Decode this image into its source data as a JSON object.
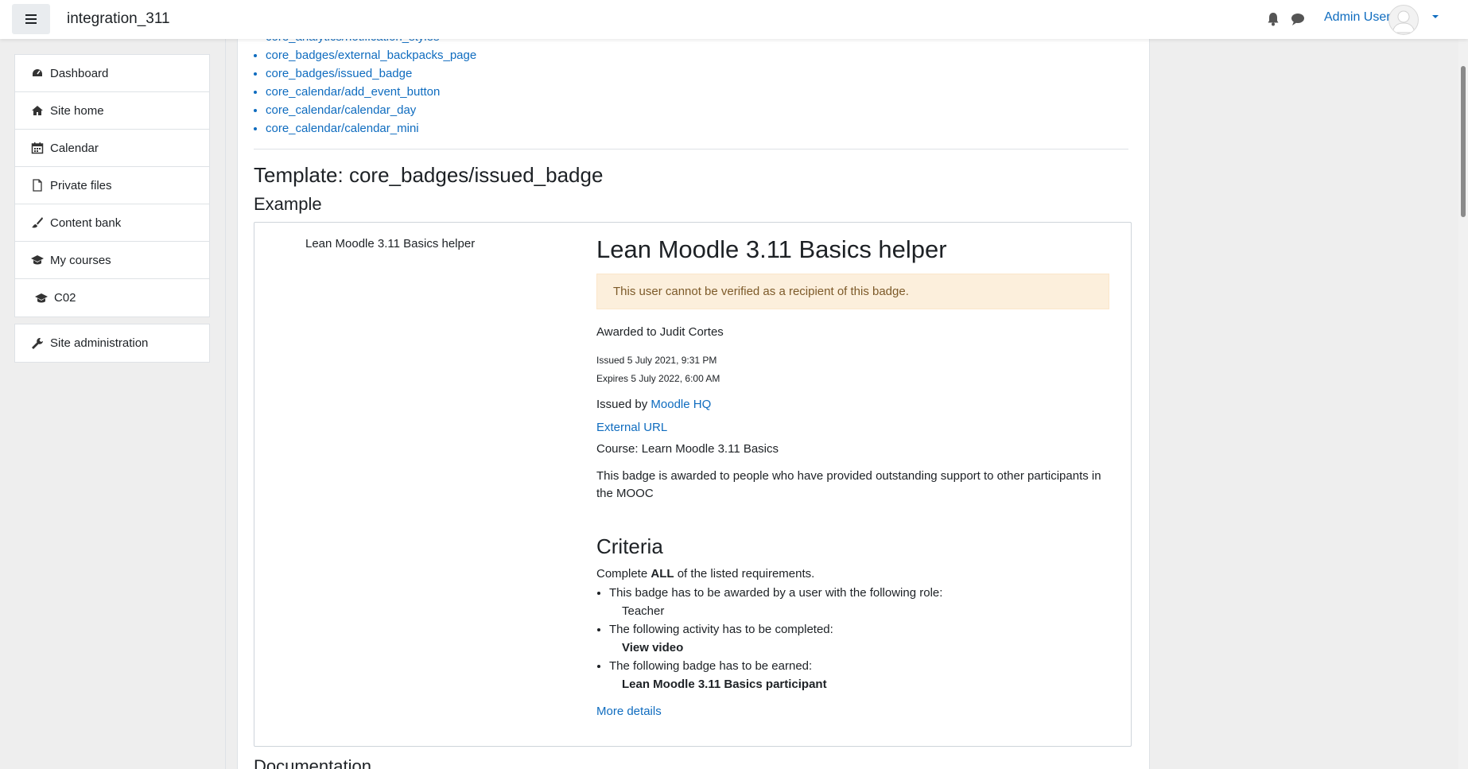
{
  "header": {
    "site_name": "integration_311",
    "user_name": "Admin User"
  },
  "nav": {
    "group1": [
      {
        "label": "Dashboard",
        "icon": "dashboard-icon"
      },
      {
        "label": "Site home",
        "icon": "home-icon"
      },
      {
        "label": "Calendar",
        "icon": "calendar-icon"
      },
      {
        "label": "Private files",
        "icon": "file-icon"
      },
      {
        "label": "Content bank",
        "icon": "brush-icon"
      },
      {
        "label": "My courses",
        "icon": "graduation-cap-icon"
      },
      {
        "label": "C02",
        "icon": "graduation-cap-icon"
      }
    ],
    "group2": [
      {
        "label": "Site administration",
        "icon": "wrench-icon"
      }
    ]
  },
  "template_list": [
    "core_analytics/notification_styles",
    "core_badges/external_backpacks_page",
    "core_badges/issued_badge",
    "core_calendar/add_event_button",
    "core_calendar/calendar_day",
    "core_calendar/calendar_mini"
  ],
  "main": {
    "template_title": "Template: core_badges/issued_badge",
    "example_heading": "Example",
    "documentation_heading": "Documentation"
  },
  "badge": {
    "image_caption": "Lean Moodle 3.11 Basics helper",
    "name": "Lean Moodle 3.11 Basics helper",
    "alert": "This user cannot be verified as a recipient of this badge.",
    "awarded_to": "Awarded to Judit Cortes",
    "issued": "Issued 5 July 2021, 9:31 PM",
    "expires": "Expires 5 July 2022, 6:00 AM",
    "issued_by_prefix": "Issued by",
    "issuer": "Moodle HQ",
    "external_url": "External URL",
    "course": "Course: Learn Moodle 3.11 Basics",
    "description": "This badge is awarded to people who have provided outstanding support to other participants in the MOOC",
    "criteria_heading": "Criteria",
    "criteria_intro_pre": "Complete",
    "criteria_intro_bold": "ALL",
    "criteria_intro_post": "of the listed requirements.",
    "criteria": [
      {
        "text": "This badge has to be awarded by a user with the following role:",
        "detail": "Teacher",
        "bold": false
      },
      {
        "text": "The following activity has to be completed:",
        "detail": "View video",
        "bold": true
      },
      {
        "text": "The following badge has to be earned:",
        "detail": "Lean Moodle 3.11 Basics participant",
        "bold": true
      }
    ],
    "more_details": "More details"
  }
}
